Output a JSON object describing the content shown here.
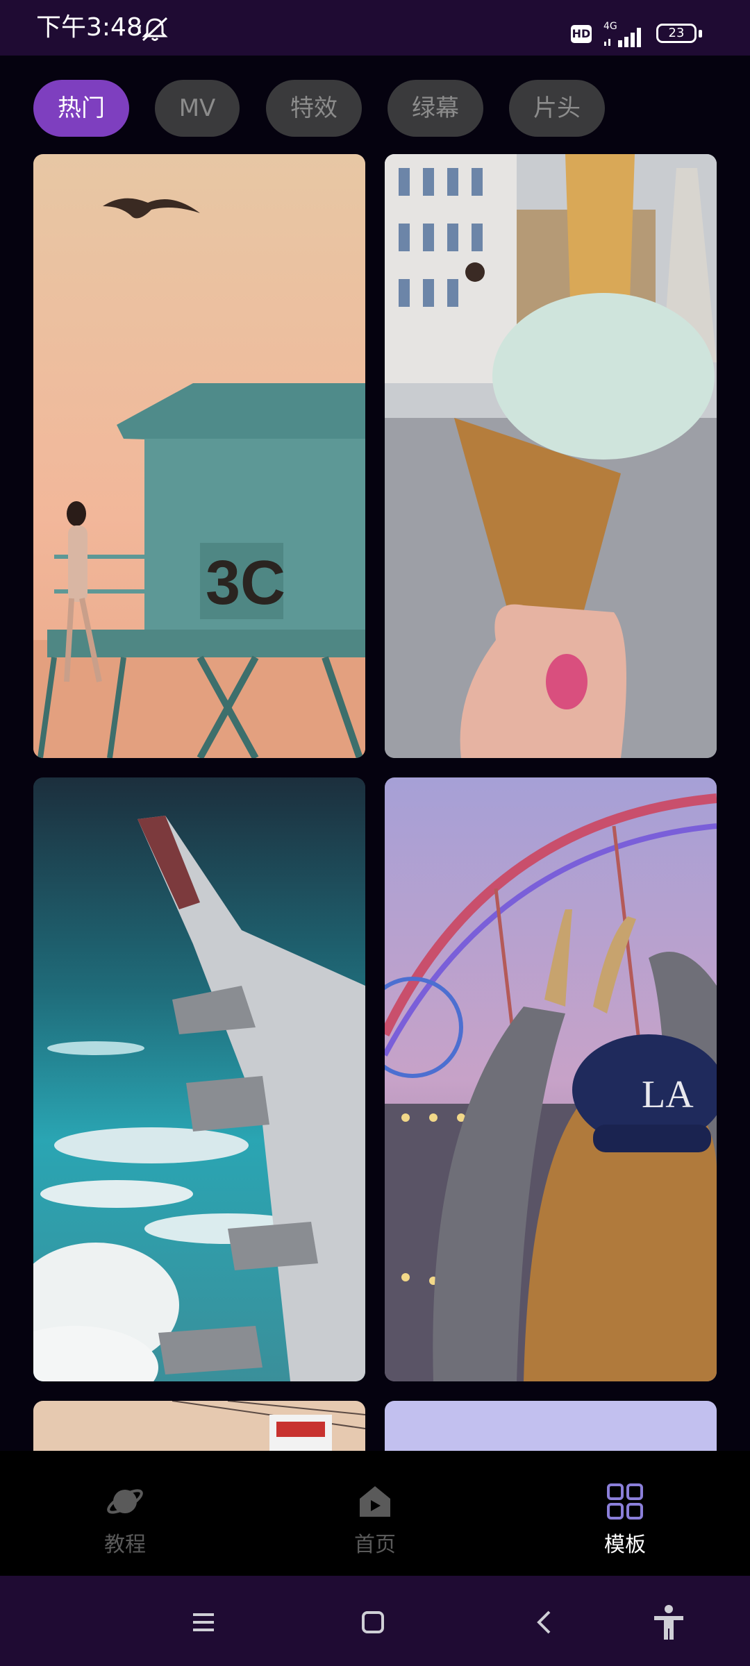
{
  "status_bar": {
    "time": "下午3:48",
    "hd_label": "HD",
    "network_label": "4G",
    "battery_level": "23",
    "icons": [
      "mute-icon",
      "hd-icon",
      "signal-icon",
      "battery-icon"
    ]
  },
  "tabs": [
    {
      "label": "热门",
      "active": true
    },
    {
      "label": "MV",
      "active": false
    },
    {
      "label": "特效",
      "active": false
    },
    {
      "label": "绿幕",
      "active": false
    },
    {
      "label": "片头",
      "active": false
    }
  ],
  "templates": [
    {
      "image": "lifeguard-tower-sunset"
    },
    {
      "image": "ice-cream-cone"
    },
    {
      "image": "airplane-wing-clouds"
    },
    {
      "image": "rollercoaster-girl-cap"
    },
    {
      "image": "street-sign-partial"
    },
    {
      "image": "sky-partial"
    }
  ],
  "bottom_nav": {
    "items": [
      {
        "label": "教程",
        "icon": "planet-icon",
        "active": false
      },
      {
        "label": "首页",
        "icon": "home-play-icon",
        "active": false
      },
      {
        "label": "模板",
        "icon": "grid-icon",
        "active": true
      }
    ]
  },
  "system_nav": {
    "icons": [
      "menu-icon",
      "home-square-icon",
      "back-icon",
      "accessibility-icon"
    ]
  },
  "colors": {
    "accent": "#7e3fbf",
    "status_bar_bg": "#1f0b33",
    "page_bg": "#05020f",
    "tab_inactive_bg": "#3a3a3c"
  }
}
